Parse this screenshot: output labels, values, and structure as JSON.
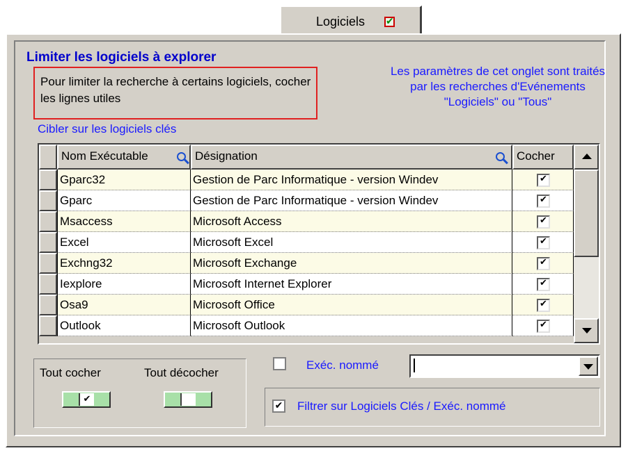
{
  "tab": {
    "label": "Logiciels",
    "checked": true
  },
  "section": {
    "title": "Limiter les logiciels à explorer",
    "hint": "Pour limiter la recherche à certains logiciels, cocher les lignes utiles",
    "note": "Les paramètres de cet onglet sont traités par les recherches d'Evénements \"Logiciels\"  ou \"Tous\"",
    "subheading": "Cibler sur les logiciels clés"
  },
  "grid": {
    "columns": [
      "Nom Exécutable",
      "Désignation",
      "Cocher"
    ],
    "rows": [
      {
        "name": "Gparc32",
        "designation": "Gestion de Parc Informatique - version Windev",
        "checked": true
      },
      {
        "name": "Gparc",
        "designation": "Gestion de Parc Informatique - version Windev",
        "checked": true
      },
      {
        "name": "Msaccess",
        "designation": "Microsoft Access",
        "checked": true
      },
      {
        "name": "Excel",
        "designation": "Microsoft Excel",
        "checked": true
      },
      {
        "name": "Exchng32",
        "designation": "Microsoft Exchange",
        "checked": true
      },
      {
        "name": "Iexplore",
        "designation": "Microsoft Internet Explorer",
        "checked": true
      },
      {
        "name": "Osa9",
        "designation": "Microsoft Office",
        "checked": true
      },
      {
        "name": "Outlook",
        "designation": "Microsoft Outlook",
        "checked": true
      }
    ]
  },
  "buttons": {
    "check_all": "Tout cocher",
    "uncheck_all": "Tout décocher"
  },
  "named_exec": {
    "label": "Exéc. nommé",
    "value": "",
    "checked": false
  },
  "filter": {
    "label": "Filtrer sur Logiciels Clés / Exéc. nommé",
    "checked": true
  },
  "check_glyph": "✔",
  "colors": {
    "row_alt": "#fcfbe6",
    "row": "#ffffff",
    "accent_text": "#1a1aff",
    "title_text": "#0000cc"
  }
}
